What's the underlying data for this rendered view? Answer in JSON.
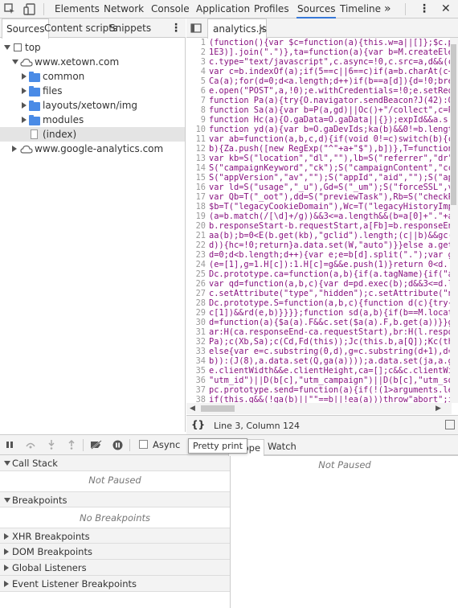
{
  "toolbar": {
    "tabs": [
      "Elements",
      "Network",
      "Console",
      "Application",
      "Profiles",
      "Sources",
      "Timeline"
    ],
    "active": "Sources",
    "more": "»",
    "menu": "⋮",
    "close": "✕"
  },
  "navigator": {
    "tabs": [
      "Sources",
      "Content scripts",
      "Snippets"
    ],
    "menu": "⋮",
    "tree": {
      "top": "top",
      "domain1": "www.xetown.com",
      "folders": [
        "common",
        "files",
        "layouts/xetown/img",
        "modules"
      ],
      "index": "(index)",
      "domain2": "www.google-analytics.com"
    }
  },
  "editor": {
    "file_tab": "analytics.js",
    "close": "×",
    "lines": [
      "(function(){var $c=function(a){this.w=a||[]};$c.p",
      "1E3)].join(\".\")},ta=function(a){var b=M.createEle",
      "c.type=\"text/javascript\",c.async=!0,c.src=a,d&&(c",
      "var c=b.indexOf(a);if(5==c||6==c)if(a=b.charAt(c+",
      "Ca(a);for(d=0;d<a.length;d++)if(b==a[d]){d=!0;bre",
      "e.open(\"POST\",a,!0);e.withCredentials=!0;e.setReq",
      "function Pa(a){try{O.navigator.sendBeacon?J(42):O",
      "function Sa(a){var b=P(a,gd)||Oc()+\"/collect\",c=P",
      "function Hc(a){O.gaData=O.gaData||{});expId&&a.s",
      "function yd(a){var b=O.gaDevIds;ka(b)&&0!=b.lengt",
      "var ab=function(a,b,c,d){if(void 0!=c)switch(b){c",
      "b){Za.push([new RegExp(\"^\"+a+\"$\"),b])},T=function",
      "var kb=S(\"location\",\"dl\",\"\"),lb=S(\"referrer\",\"dr\"",
      "S(\"campaignKeyword\",\"ck\");S(\"campaignContent\",\"cc",
      "S(\"appVersion\",\"av\",\"\");S(\"appId\",\"aid\",\"\");S(\"ap",
      "var ld=S(\"usage\",\"_u\"),Gd=S(\"_um\");S(\"forceSSL\",v",
      "var Qb=T(\"_oot\"),dd=S(\"previewTask\"),Rb=S(\"checkP",
      "$b=T(\"legacyCookieDomain\"),Wc=T(\"legacyHistoryImp",
      "(a=b.match(/[\\d]+/g))&&3<=a.length&&(b=a[0]+\".\"+a",
      "b.responseStart-b.requestStart,a[Fb]=b.responseEn",
      "aa(b);b=0<E(b.get(kb),\"gclid\").length;(c||b)&&gc(",
      "d)){hc=!0;return}a.data.set(W,\"auto\")}}else a.get",
      "d=0;d<b.length;d++){var e;e=b[d].split(\".\");var g",
      "(e=[1],g=1.H[c]):1.H[c]=g&&e.push(1)}return 0<d.",
      "Dc.prototype.ca=function(a,b){if(a.tagName){if(\"a",
      "var qd=function(a,b,c){var d=pd.exec(b);d&&3<=d.l",
      "c.setAttribute(\"type\",\"hidden\");c.setAttribute(\"n",
      "Dc.prototype.S=function(a,b,c){function d(c){try{",
      "c[1])&&rd(e,b)}}}};function sd(a,b){if(b==M.locat",
      "d=function(a){$a(a).F&&c.set($a(a).F,b.get(a))}}g",
      "ar:H(ca.responseEnd-ca.requestStart),br:H(l.respo",
      "Pa);c(Xb,Sa);c(Cd,Fd(this));Jc(this.b,a[Q]);Kc(th",
      "else{var e=c.substring(0,d),g=c.substring(d+1),d=",
      "b)):(J(8),a.data.set(Q,ga(a))));a.data.set(ja,a.ge",
      "e.clientWidth&&e.clientHeight,ca=[];c&&c.clientWi",
      "\"utm_id\")||D(b[c],\"utm_campaign\")||D(b[c],\"utm_so",
      "pc.prototype.send=function(a){if(!(1>arguments.le",
      "if(this.g&&(!ga(b)||\"\"==b||!ea(a)))throw\"abort\";i"
    ],
    "status": "Line 3, Column 124",
    "format_icon": "{}"
  },
  "debugger": {
    "async_label": "Async",
    "tooltip": "Pretty print",
    "sections_left": [
      "Call Stack",
      "Breakpoints",
      "XHR Breakpoints",
      "DOM Breakpoints",
      "Global Listeners",
      "Event Listener Breakpoints"
    ],
    "not_paused": "Not Paused",
    "no_breakpoints": "No Breakpoints",
    "right_tabs": [
      "Scope",
      "Watch"
    ],
    "right_not_paused": "Not Paused"
  },
  "colors": {
    "accent": "#3879d9",
    "folder": "#4a8be6",
    "code": "#881280"
  }
}
